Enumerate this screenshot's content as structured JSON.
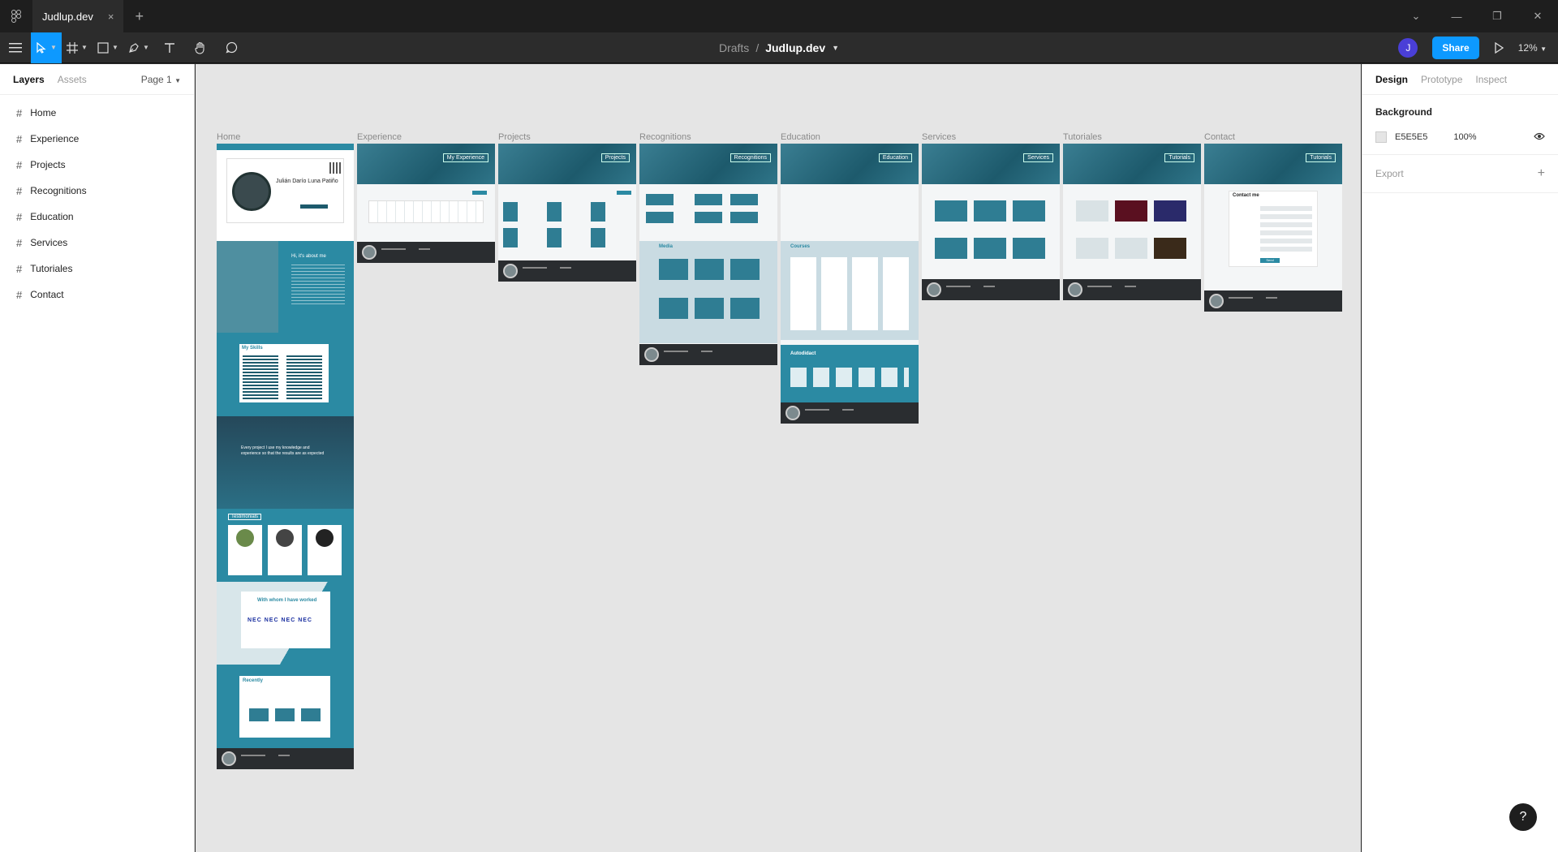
{
  "app": {
    "tab_title": "Judlup.dev",
    "tab_close": "×",
    "new_tab": "+"
  },
  "window": {
    "minimize": "—",
    "restore": "❐",
    "close": "✕",
    "dropdown": "⌄"
  },
  "toolbar": {
    "menu_icon": "menu-icon",
    "tools": [
      "move-tool",
      "frame-tool",
      "shape-tool",
      "pen-tool",
      "text-tool",
      "hand-tool",
      "comment-tool"
    ],
    "breadcrumb_parent": "Drafts",
    "breadcrumb_sep": "/",
    "file_name": "Judlup.dev",
    "avatar_initial": "J",
    "share_label": "Share",
    "zoom": "12%"
  },
  "left_panel": {
    "tabs": [
      "Layers",
      "Assets"
    ],
    "page": "Page 1",
    "layers": [
      "Home",
      "Experience",
      "Projects",
      "Recognitions",
      "Education",
      "Services",
      "Tutoriales",
      "Contact"
    ]
  },
  "canvas": {
    "background": "#E5E5E5",
    "frames": [
      "Home",
      "Experience",
      "Projects",
      "Recognitions",
      "Education",
      "Services",
      "Tutoriales",
      "Contact"
    ],
    "hero_labels": {
      "experience": "My Experience",
      "projects": "Projects",
      "recognitions": "Recognitions",
      "education": "Education",
      "services": "Services",
      "tutoriales": "Tutorials"
    },
    "home_texts": {
      "name": "Julián Darío Luna Patiño",
      "about": "Hi, it's about me",
      "skills": "My Skills",
      "testimonials": "Testimonials",
      "worked": "With whom I have worked",
      "recently": "Recently",
      "quote": "Every project I use my knowledge and experience so that the results are as expected",
      "client_logo": "NEC"
    },
    "recognitions_texts": {
      "media": "Media"
    },
    "education_texts": {
      "courses": "Courses",
      "autodidact": "Autodidact"
    },
    "contact_texts": {
      "contact": "Contact me",
      "send": "Send"
    }
  },
  "right_panel": {
    "tabs": [
      "Design",
      "Prototype",
      "Inspect"
    ],
    "background_title": "Background",
    "background_hex": "E5E5E5",
    "background_opacity": "100%",
    "export_title": "Export"
  },
  "help": "?"
}
